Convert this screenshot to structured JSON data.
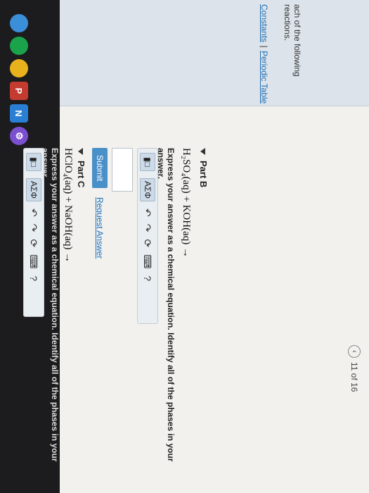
{
  "sidebar": {
    "constants_link": "Constants",
    "separator": "|",
    "periodic_link": "Periodic Table",
    "prompt_line1": "ach of the following",
    "prompt_line2": "reactions."
  },
  "pager": {
    "label": "11 of 16",
    "back_icon": "chevron-left-icon"
  },
  "part_b": {
    "title": "Part B",
    "equation": "H₂SO₄(aq) + KOH(aq) →",
    "instruction": "Express your answer as a chemical equation. Identify all of the phases in your answer.",
    "toolbar": {
      "template_btn": "▮□",
      "symbols_btn": "AΣΦ",
      "undo": "↶",
      "redo": "↷",
      "reset": "⟳",
      "keyboard": "⌨",
      "help": "?"
    },
    "submit": "Submit",
    "request": "Request Answer"
  },
  "part_c": {
    "title": "Part C",
    "equation": "HClO₄(aq) + NaOH(aq) →",
    "instruction": "Express your answer as a chemical equation. Identify all of the phases in your answer.",
    "toolbar": {
      "template_btn": "▮□",
      "symbols_btn": "AΣΦ",
      "undo": "↶",
      "redo": "↷",
      "reset": "⟳",
      "keyboard": "⌨",
      "help": "?"
    }
  },
  "taskbar": {
    "items": [
      "",
      "",
      "",
      "P",
      "N",
      "⚙"
    ],
    "colors": [
      "#3b8fd9",
      "#1aa34a",
      "#e8b21c",
      "#c43b2f",
      "#2a7fd4",
      "#7a4fd0"
    ]
  }
}
